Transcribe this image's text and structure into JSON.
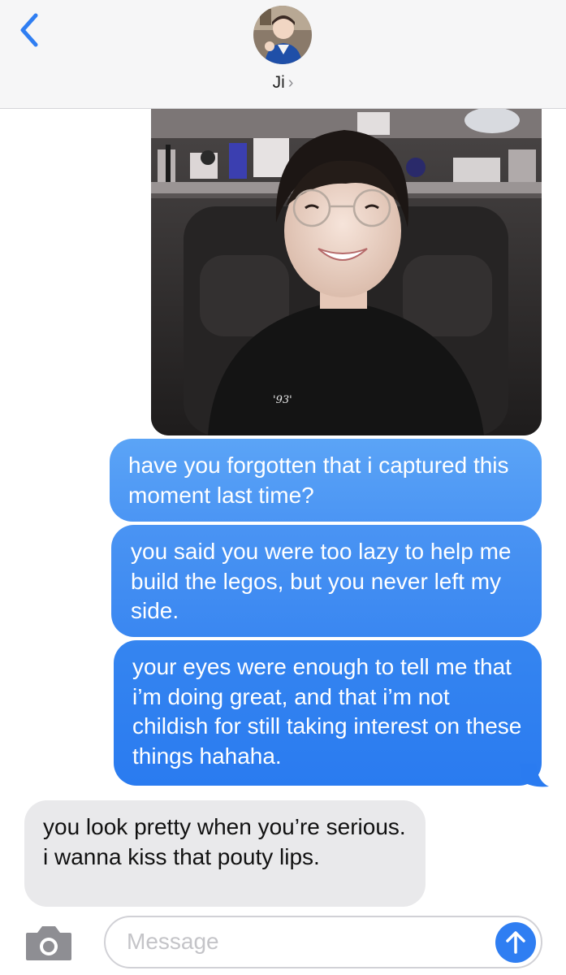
{
  "header": {
    "contact_name": "Ji",
    "chevron": "›",
    "back_icon": "chevron-left-icon",
    "avatar": "contact-avatar"
  },
  "conversation": {
    "photo": "shared-photo",
    "messages": [
      {
        "direction": "sent",
        "text": "have you forgotten that i captured this moment last time?"
      },
      {
        "direction": "sent",
        "text": "you said you were too lazy to help me build the legos, but you never left my side."
      },
      {
        "direction": "sent",
        "text": "your eyes were enough to tell me that i’m doing great, and that i’m not childish for still taking interest on these things hahaha."
      },
      {
        "direction": "received",
        "text": "you look pretty when you’re serious. i wanna kiss that pouty lips."
      }
    ]
  },
  "input_bar": {
    "placeholder": "Message",
    "camera_icon": "camera-icon",
    "send_icon": "arrow-up-icon"
  },
  "colors": {
    "accent": "#2f7ef2",
    "header_bg": "#f6f6f7",
    "received_bg": "#e9e9eb",
    "placeholder": "#c4c4c8"
  }
}
